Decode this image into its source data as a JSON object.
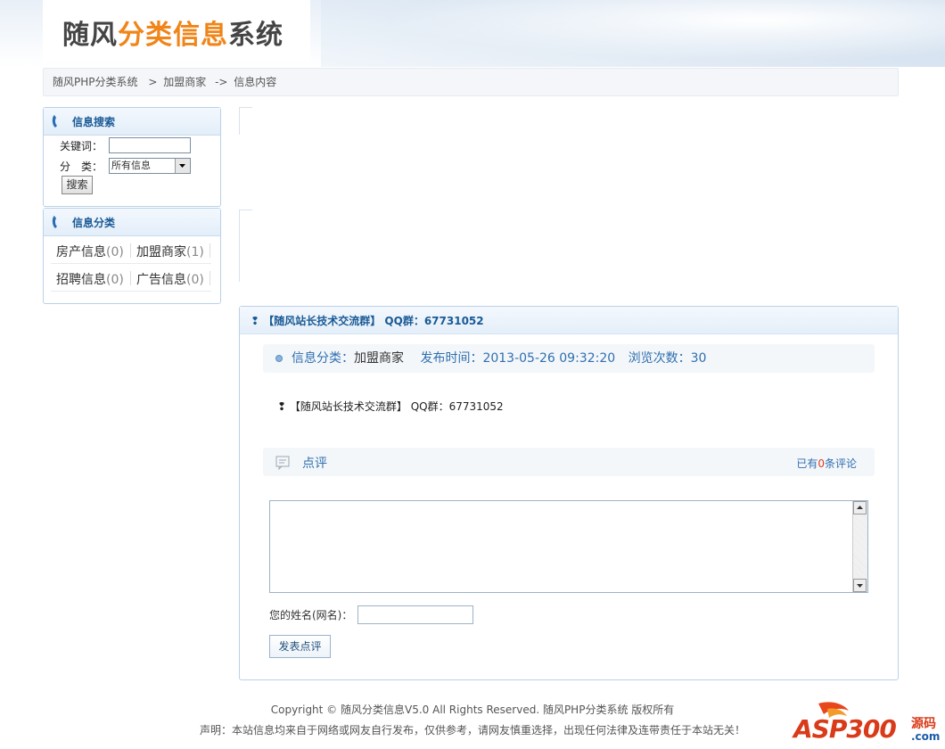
{
  "header": {
    "logo_part1": "随风",
    "logo_part2": "分类信息",
    "logo_part3": "系统"
  },
  "breadcrumb": {
    "home": "随风PHP分类系统",
    "sep1": ">",
    "category": "加盟商家",
    "sep2": "->",
    "current": "信息内容"
  },
  "search_box": {
    "title": "信息搜索",
    "keyword_label": "关键词：",
    "keyword_value": "",
    "category_label": "分　类：",
    "category_selected": "所有信息",
    "search_button": "搜索"
  },
  "category_box": {
    "title": "信息分类",
    "items": [
      {
        "name": "房产信息",
        "count": "(0)"
      },
      {
        "name": "加盟商家",
        "count": "(1)"
      },
      {
        "name": "招聘信息",
        "count": "(0)"
      },
      {
        "name": "广告信息",
        "count": "(0)"
      }
    ]
  },
  "post": {
    "title": "【随风站长技术交流群】 QQ群：67731052",
    "category_label": "信息分类：",
    "category_value": "加盟商家",
    "time_label": "发布时间：",
    "time_value": "2013-05-26 09:32:20",
    "views_label": "浏览次数：",
    "views_value": "30",
    "content": "【随风站长技术交流群】 QQ群：67731052"
  },
  "comments": {
    "title": "点评",
    "count_prefix": "已有",
    "count_value": "0",
    "count_suffix": "条评论",
    "textarea_value": "",
    "name_label": "您的姓名(网名)：",
    "name_value": "",
    "submit_button": "发表点评"
  },
  "footer": {
    "copyright": "Copyright © 随风分类信息V5.0  All Rights Reserved.   随风PHP分类系统   版权所有",
    "disclaimer": "声明：本站信息均来自于网络或网友自行发布，仅供参考，请网友慎重选择，出现任何法律及连带责任于本站无关！",
    "brand_main": "ASP300",
    "brand_cn": "源码",
    "brand_com": ".com"
  },
  "colors": {
    "accent_orange": "#f08519",
    "link_blue": "#2f6fb0",
    "title_blue": "#1a5a96",
    "border_blue": "#b9d2ea",
    "count_red": "#e03c1e"
  }
}
